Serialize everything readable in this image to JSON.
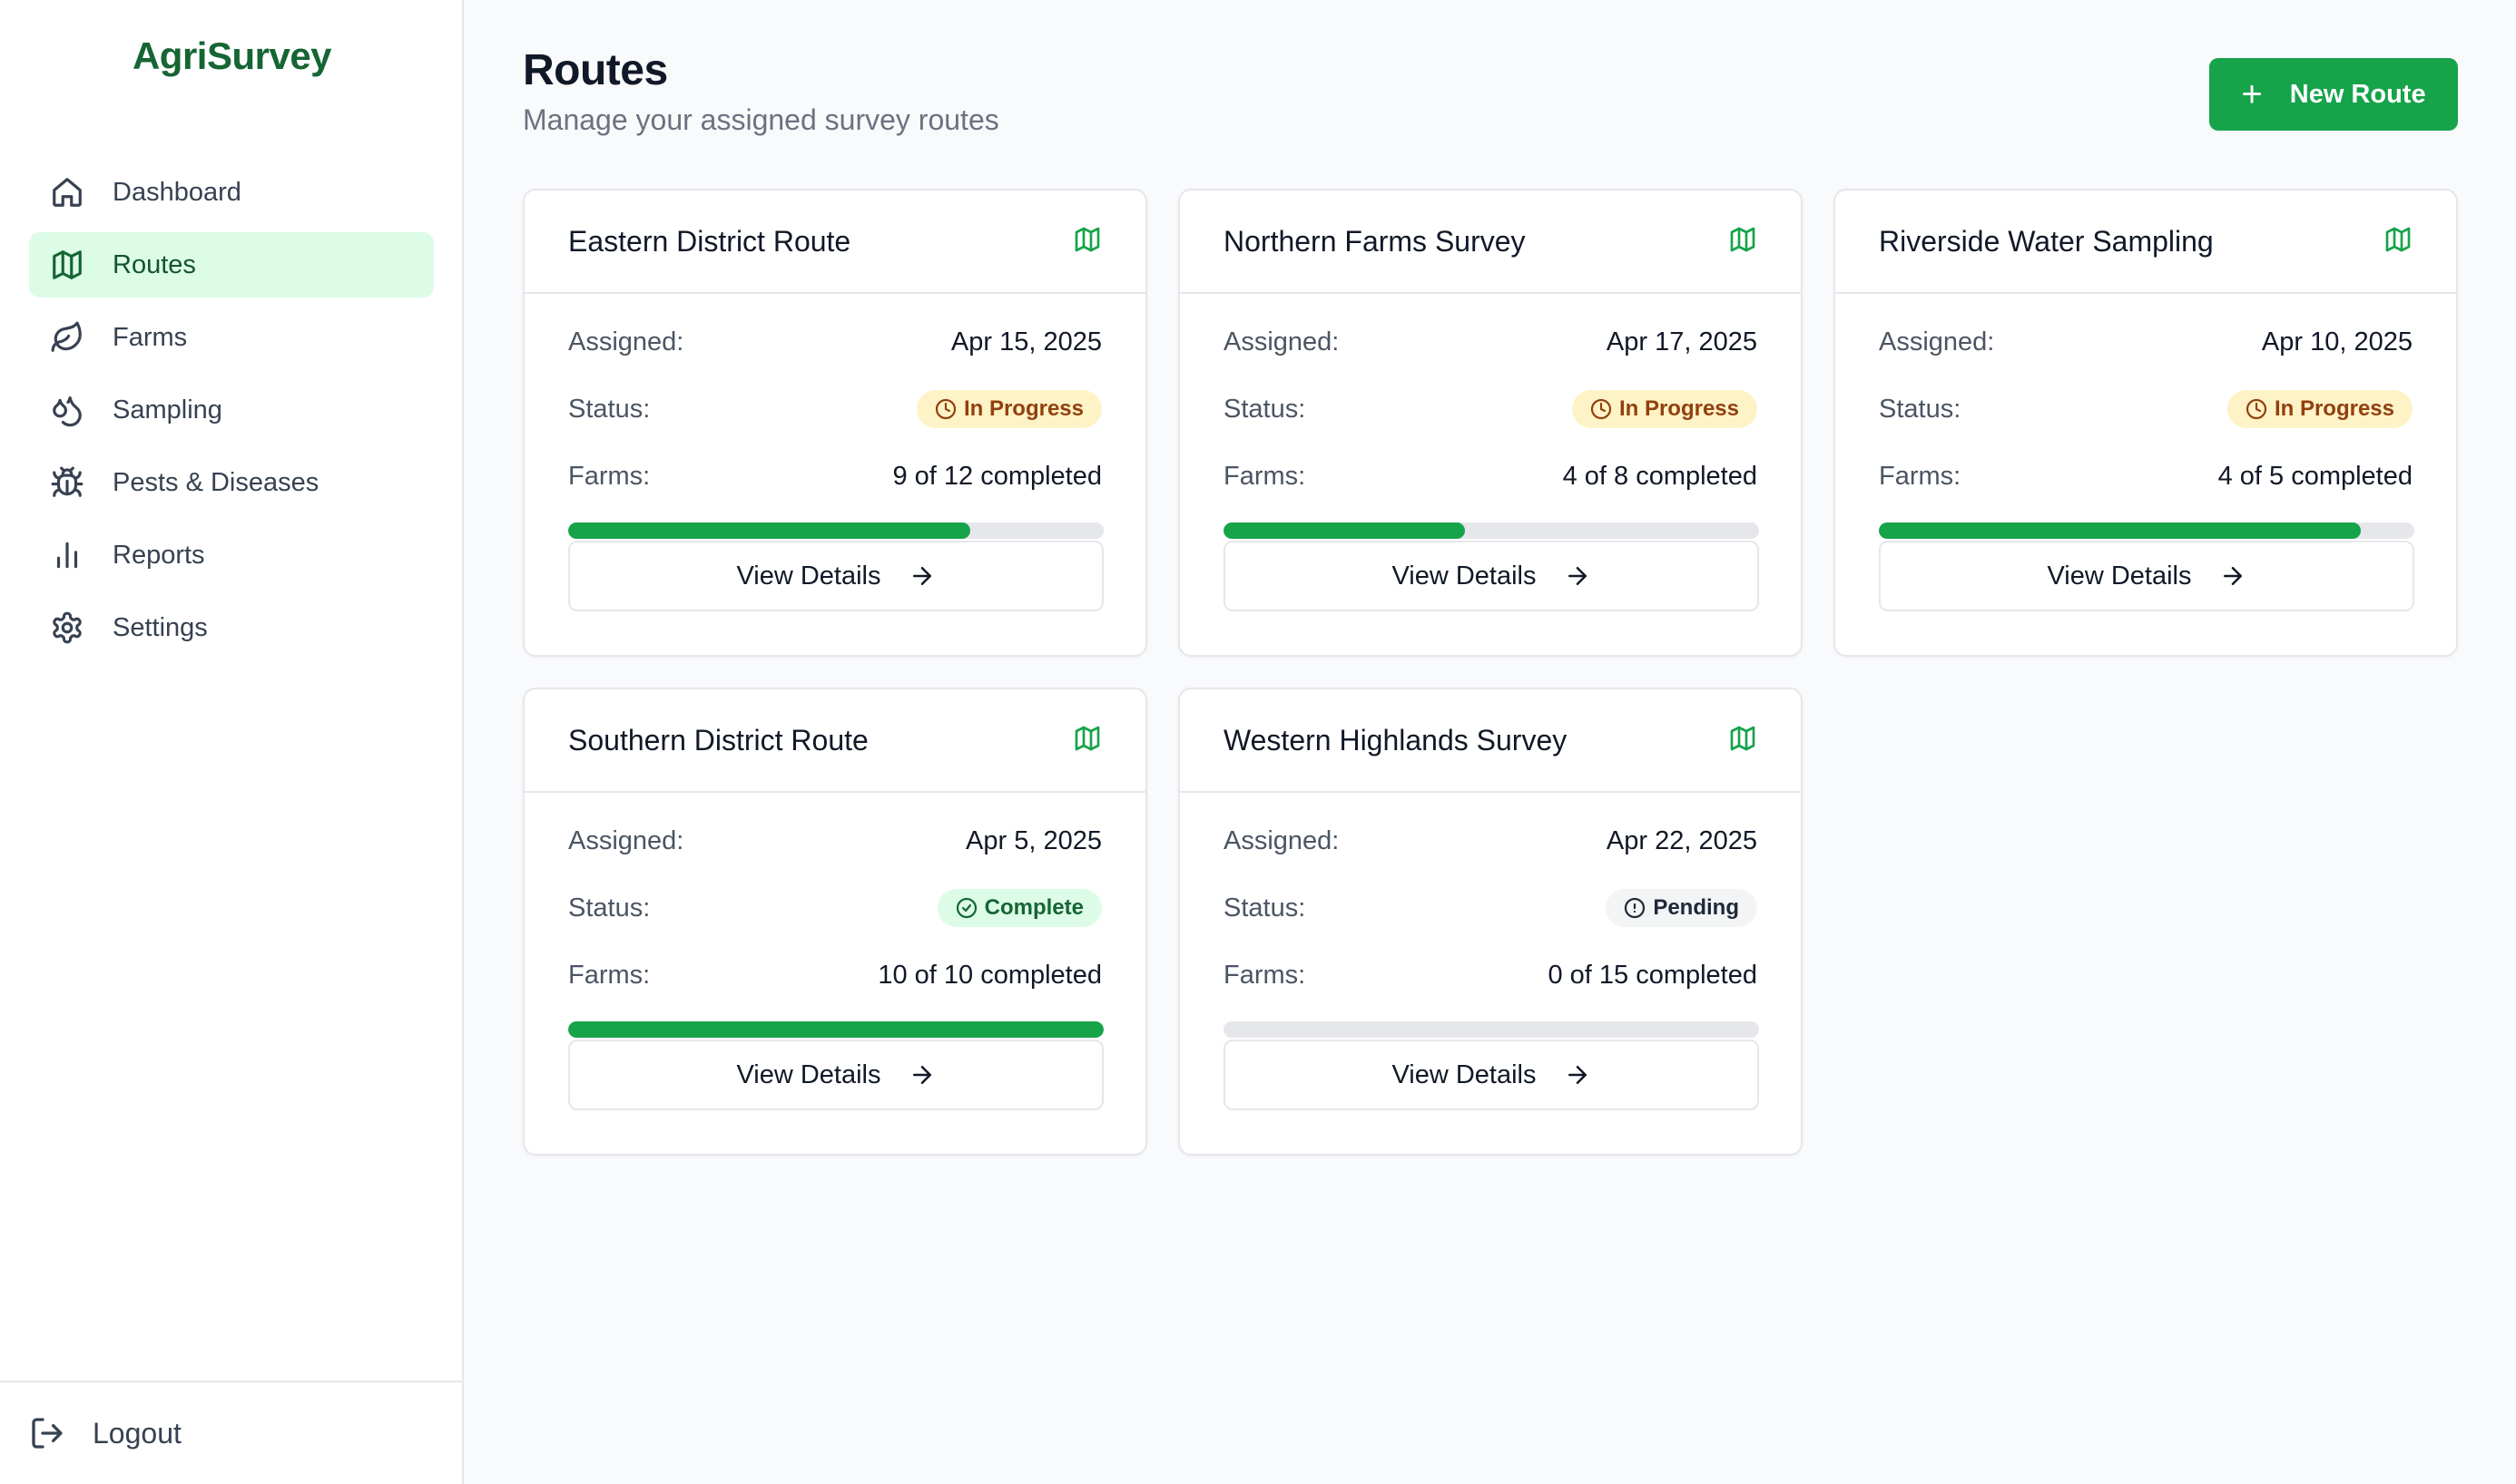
{
  "app": {
    "brand": "AgriSurvey"
  },
  "sidebar": {
    "items": [
      {
        "label": "Dashboard",
        "icon": "home-icon",
        "active": false
      },
      {
        "label": "Routes",
        "icon": "map-icon",
        "active": true
      },
      {
        "label": "Farms",
        "icon": "leaf-icon",
        "active": false
      },
      {
        "label": "Sampling",
        "icon": "droplets-icon",
        "active": false
      },
      {
        "label": "Pests & Diseases",
        "icon": "bug-icon",
        "active": false
      },
      {
        "label": "Reports",
        "icon": "bar-chart-icon",
        "active": false
      },
      {
        "label": "Settings",
        "icon": "gear-icon",
        "active": false
      }
    ],
    "logout_label": "Logout"
  },
  "header": {
    "title": "Routes",
    "subtitle": "Manage your assigned survey routes",
    "new_route_label": "New Route"
  },
  "labels": {
    "assigned": "Assigned:",
    "status": "Status:",
    "farms": "Farms:",
    "view_details": "View Details"
  },
  "colors": {
    "brand": "#166534",
    "accent": "#16a34a",
    "in_progress_bg": "#fef3c7",
    "complete_bg": "#dcfce7",
    "pending_bg": "#f3f4f6"
  },
  "routes": [
    {
      "name": "Eastern District Route",
      "assigned": "Apr 15, 2025",
      "status": "In Progress",
      "status_kind": "progress",
      "farms": "9 of 12 completed",
      "progress": 0.75
    },
    {
      "name": "Northern Farms Survey",
      "assigned": "Apr 17, 2025",
      "status": "In Progress",
      "status_kind": "progress",
      "farms": "4 of 8 completed",
      "progress": 0.45
    },
    {
      "name": "Riverside Water Sampling",
      "assigned": "Apr 10, 2025",
      "status": "In Progress",
      "status_kind": "progress",
      "farms": "4 of 5 completed",
      "progress": 0.9
    },
    {
      "name": "Southern District Route",
      "assigned": "Apr 5, 2025",
      "status": "Complete",
      "status_kind": "complete",
      "farms": "10 of 10 completed",
      "progress": 1.0
    },
    {
      "name": "Western Highlands Survey",
      "assigned": "Apr 22, 2025",
      "status": "Pending",
      "status_kind": "pending",
      "farms": "0 of 15 completed",
      "progress": 0.0
    }
  ]
}
